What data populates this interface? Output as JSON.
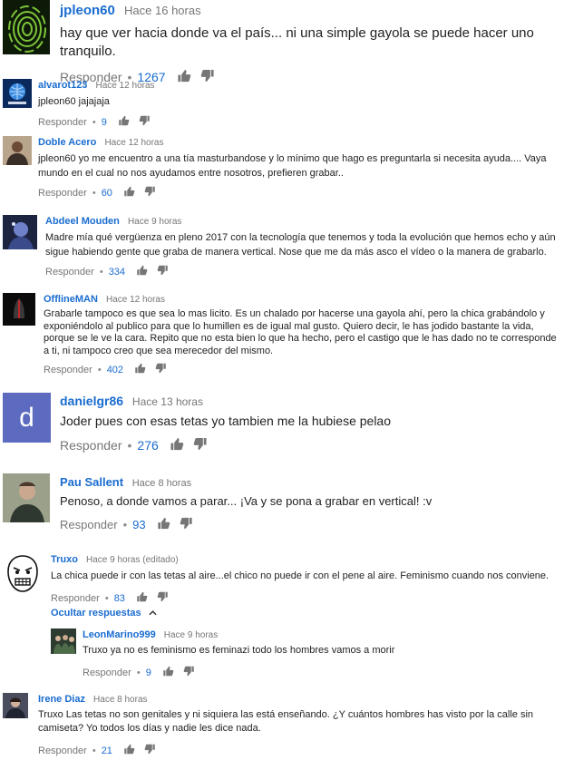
{
  "comments": [
    {
      "author": "jpleon60",
      "time": "Hace 16 horas",
      "text": "hay que ver hacia donde va el país... ni una simple gayola se puede hacer uno tranquilo.",
      "reply": "Responder",
      "likes": "1267",
      "avatar_icon": "fingerprint-icon"
    },
    {
      "author": "alvarot123",
      "time": "Hace 12 horas",
      "text": "jpleon60 jajajaja",
      "reply": "Responder",
      "likes": "9",
      "avatar_icon": "globe-icon"
    },
    {
      "author": "Doble Acero",
      "time": "Hace 12 horas",
      "text": "jpleon60 yo me encuentro a una tía masturbandose y lo mínimo que hago es preguntarla si necesita ayuda.... Vaya mundo en el cual no nos ayudamos entre nosotros, prefieren grabar..",
      "reply": "Responder",
      "likes": "60",
      "avatar_icon": "person-photo-icon"
    },
    {
      "author": "Abdeel Mouden",
      "time": "Hace 9 horas",
      "text": "Madre mía qué vergüenza en pleno 2017 con la tecnología que tenemos y toda la evolución que hemos echo y aún sigue habiendo gente que graba de manera vertical. Nose que me da más asco el vídeo o la manera de grabarlo.",
      "reply": "Responder",
      "likes": "334",
      "avatar_icon": "fantasy-art-icon"
    },
    {
      "author": "OfflineMAN",
      "time": "Hace 12 horas",
      "text": "Grabarle tampoco es que sea lo mas licito. Es un chalado por hacerse una gayola ahí, pero la chica grabándolo y exponiéndolo al publico para que lo humillen es de igual mal gusto. Quiero decir, le has jodido bastante la vida, porque se le ve la cara. Repito que no esta bien lo que ha hecho, pero el castigo que le has dado no te corresponde a ti, ni tampoco creo que sea merecedor del mismo.",
      "reply": "Responder",
      "likes": "402",
      "avatar_icon": "dark-figure-icon"
    },
    {
      "author": "danielgr86",
      "time": "Hace 13 horas",
      "text": "Joder pues con esas tetas yo tambien me la hubiese pelao",
      "reply": "Responder",
      "likes": "276",
      "avatar_icon": "letter-d-icon",
      "avatar_letter": "d"
    },
    {
      "author": "Pau Sallent",
      "time": "Hace 8 horas",
      "text": "Penoso, a donde vamos a parar... ¡Va y se pona a grabar en vertical! :v",
      "reply": "Responder",
      "likes": "93",
      "avatar_icon": "person-photo-icon"
    },
    {
      "author": "Truxo",
      "time": "Hace 9 horas (editado)",
      "text": "La chica puede ir con las tetas al aire...el chico no puede ir con el pene al aire. Feminismo cuando nos conviene.",
      "reply": "Responder",
      "likes": "83",
      "avatar_icon": "rage-face-icon"
    },
    {
      "author": "LeonMarino999",
      "time": "Hace 9 horas",
      "text": "Truxo ya no es feminismo es feminazi todo los hombres vamos a morir",
      "reply": "Responder",
      "likes": "9",
      "avatar_icon": "group-photo-icon"
    },
    {
      "author": "Irene Diaz",
      "time": "Hace 8 horas",
      "text": "Truxo Las tetas no son genitales y ni siquiera las está enseñando. ¿Y cuántos hombres has visto por la calle sin camiseta? Yo todos los días y nadie les dice nada.",
      "reply": "Responder",
      "likes": "21",
      "avatar_icon": "person-photo-icon"
    }
  ],
  "hide_replies_label": "Ocultar respuestas",
  "colors": {
    "author": "#1a6ccf",
    "likes": "#1a6ccf",
    "muted": "#767676",
    "letter_avatar_bg": "#5c6bc0"
  }
}
